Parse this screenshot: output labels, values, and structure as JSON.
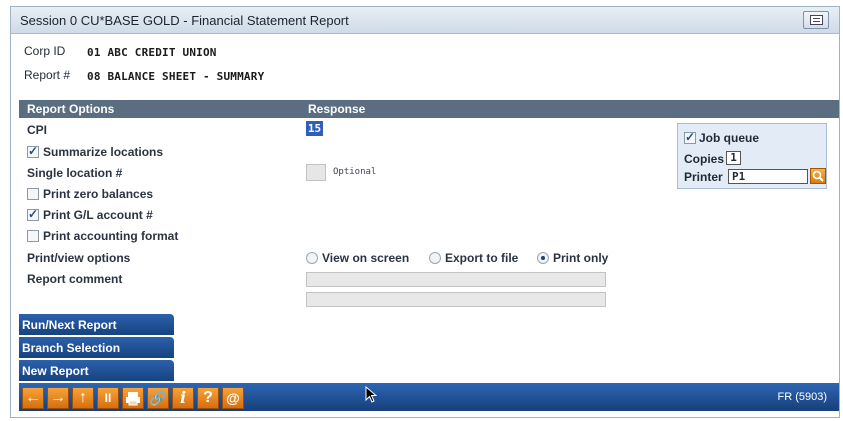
{
  "window": {
    "title": "Session 0 CU*BASE GOLD - Financial Statement Report"
  },
  "header": {
    "corp_label": "Corp ID",
    "corp_value": "01 ABC CREDIT UNION",
    "report_label": "Report #",
    "report_value": "08 BALANCE SHEET - SUMMARY"
  },
  "section": {
    "options_label": "Report Options",
    "response_label": "Response"
  },
  "form": {
    "cpi_label": "CPI",
    "cpi_value": "15",
    "summarize_label": "Summarize locations",
    "summarize_checked": true,
    "single_location_label": "Single location #",
    "single_location_value": "",
    "optional_text": "Optional",
    "print_zero_label": "Print zero balances",
    "print_zero_checked": false,
    "print_gl_label": "Print G/L account #",
    "print_gl_checked": true,
    "accounting_label": "Print accounting format",
    "accounting_checked": false,
    "print_view_label": "Print/view options",
    "view_options": [
      "View on screen",
      "Export to file",
      "Print only"
    ],
    "view_selected": "Print only",
    "report_comment_label": "Report comment",
    "report_comment_line1": "",
    "report_comment_line2": ""
  },
  "job": {
    "job_queue_label": "Job queue",
    "job_queue_checked": true,
    "copies_label": "Copies",
    "copies_value": "1",
    "printer_label": "Printer",
    "printer_value": "P1"
  },
  "side_buttons": [
    "Run/Next Report",
    "Branch Selection",
    "New Report"
  ],
  "toolbar": {
    "icons": [
      "back-arrow-icon",
      "forward-arrow-icon",
      "up-arrow-icon",
      "pause-icon",
      "printer-icon",
      "link-icon",
      "info-icon",
      "help-icon",
      "at-sign-icon"
    ],
    "screen_code": "FR (5903)"
  },
  "colors": {
    "toolbar_blue": "#173f7a",
    "accent_orange": "#d66f0d",
    "header_gray": "#5b6d80",
    "selected_field": "#2f5fb8"
  }
}
